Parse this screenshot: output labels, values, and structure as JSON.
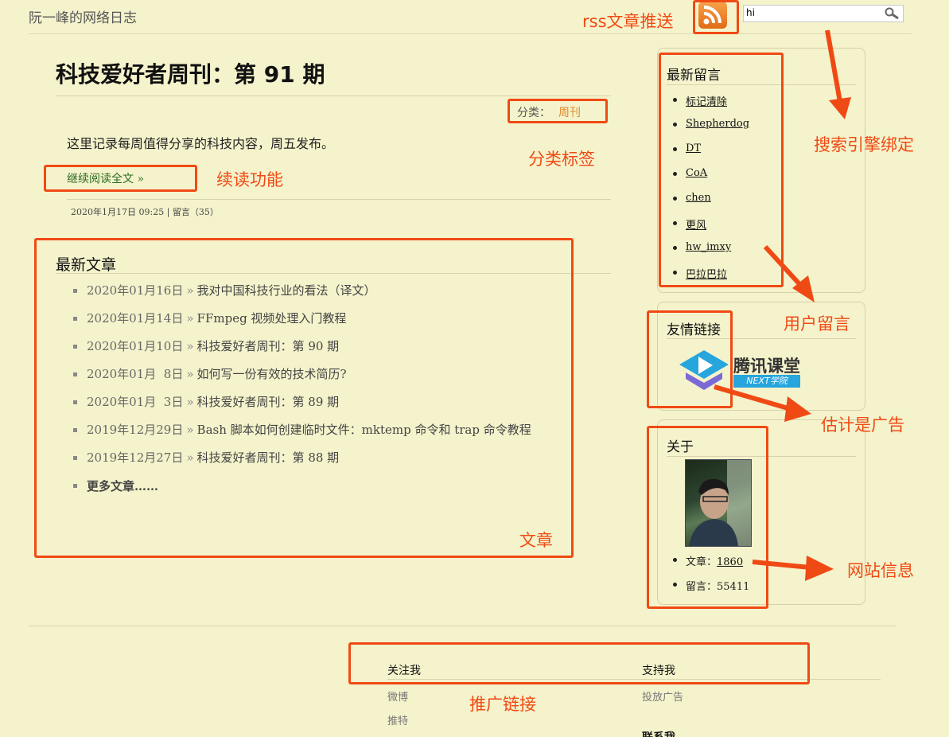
{
  "header": {
    "site_title": "阮一峰的网络日志",
    "search_value": "hi"
  },
  "post": {
    "title": "科技爱好者周刊：第 91 期",
    "category_label": "分类：",
    "category_value": "周刊",
    "summary": "这里记录每周值得分享的科技内容，周五发布。",
    "read_more": "继续阅读全文 »",
    "meta": "2020年1月17日 09:25 | 留言（35）"
  },
  "recent": {
    "title": "最新文章",
    "items": [
      {
        "date": "2020年01月16日",
        "title": "我对中国科技行业的看法（译文）"
      },
      {
        "date": "2020年01月14日",
        "title": "FFmpeg 视频处理入门教程"
      },
      {
        "date": "2020年01月10日",
        "title": "科技爱好者周刊：第 90 期"
      },
      {
        "date": "2020年01月  8日",
        "title": "如何写一份有效的技术简历?"
      },
      {
        "date": "2020年01月  3日",
        "title": "科技爱好者周刊：第 89 期"
      },
      {
        "date": "2019年12月29日",
        "title": "Bash 脚本如何创建临时文件：mktemp 命令和 trap 命令教程"
      },
      {
        "date": "2019年12月27日",
        "title": "科技爱好者周刊：第 88 期"
      }
    ],
    "separator": "»",
    "more": "更多文章……"
  },
  "sidebar": {
    "comments_title": "最新留言",
    "comments": [
      "标记清除",
      "Shepherdog",
      "DT",
      "CoA",
      "chen",
      "更风",
      "hw_imxy",
      "巴拉巴拉"
    ],
    "links_title": "友情链接",
    "ad_text": "腾讯课堂",
    "ad_badge": "NEXT学院",
    "about_title": "关于",
    "about_articles_label": "文章：",
    "about_articles_value": "1860",
    "about_comments_label": "留言：",
    "about_comments_value": "55411"
  },
  "footer": {
    "follow_title": "关注我",
    "follow_links": [
      "微博",
      "推特"
    ],
    "support_title": "支持我",
    "support_links": [
      "投放广告"
    ],
    "contact_partial": "联系我"
  },
  "annotations": {
    "rss": "rss文章推送",
    "search": "搜索引擎绑定",
    "category": "分类标签",
    "read_more": "续读功能",
    "articles": "文章",
    "comments": "用户留言",
    "ads": "估计是广告",
    "site_info": "网站信息",
    "promo": "推广链接",
    "color": "#f04a14"
  }
}
